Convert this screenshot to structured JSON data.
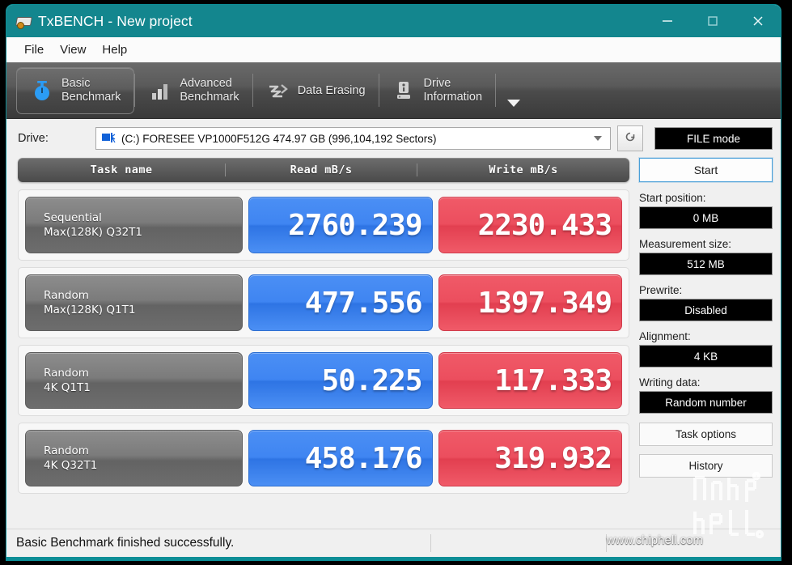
{
  "window": {
    "title": "TxBENCH - New project",
    "app_icon": "drive-bench-icon",
    "controls": {
      "minimize": "minimize-icon",
      "maximize": "maximize-icon",
      "close": "close-icon"
    },
    "titlebar_color": "#13868e"
  },
  "menubar": {
    "items": [
      {
        "label": "File"
      },
      {
        "label": "View"
      },
      {
        "label": "Help"
      }
    ]
  },
  "tabs": [
    {
      "label": "Basic\nBenchmark",
      "icon": "stopwatch-icon",
      "selected": true
    },
    {
      "label": "Advanced\nBenchmark",
      "icon": "bar-chart-icon",
      "selected": false
    },
    {
      "label": "Data Erasing",
      "icon": "eraser-wave-icon",
      "selected": false
    },
    {
      "label": "Drive\nInformation",
      "icon": "drive-info-icon",
      "selected": false
    }
  ],
  "tab_overflow": {
    "icon": "chevron-down-icon"
  },
  "drive": {
    "label": "Drive:",
    "icon": "drive-icon",
    "selected_text": "(C:) FORESEE VP1000F512G  474.97 GB (996,104,192 Sectors)",
    "dropdown_icon": "chevron-down-icon",
    "refresh_icon": "refresh-icon",
    "file_mode_label": "FILE mode"
  },
  "results": {
    "columns": [
      "Task name",
      "Read mB/s",
      "Write mB/s"
    ],
    "rows": [
      {
        "task_line1": "Sequential",
        "task_line2": "Max(128K) Q32T1",
        "read": "2760.239",
        "write": "2230.433"
      },
      {
        "task_line1": "Random",
        "task_line2": "Max(128K) Q1T1",
        "read": "477.556",
        "write": "1397.349"
      },
      {
        "task_line1": "Random",
        "task_line2": "4K Q1T1",
        "read": "50.225",
        "write": "117.333"
      },
      {
        "task_line1": "Random",
        "task_line2": "4K Q32T1",
        "read": "458.176",
        "write": "319.932"
      }
    ],
    "read_color": "#3f85f2",
    "write_color": "#ec4e5e"
  },
  "sidebar": {
    "start_label": "Start",
    "fields": [
      {
        "label": "Start position:",
        "value": "0 MB"
      },
      {
        "label": "Measurement size:",
        "value": "512 MB"
      },
      {
        "label": "Prewrite:",
        "value": "Disabled"
      },
      {
        "label": "Alignment:",
        "value": "4 KB"
      },
      {
        "label": "Writing data:",
        "value": "Random number"
      }
    ],
    "buttons": [
      {
        "label": "Task options"
      },
      {
        "label": "History"
      }
    ]
  },
  "statusbar": {
    "message": "Basic Benchmark finished successfully."
  },
  "watermark": {
    "url": "www.chiphell.com",
    "logo_top": "chip",
    "logo_bottom": "hell"
  }
}
